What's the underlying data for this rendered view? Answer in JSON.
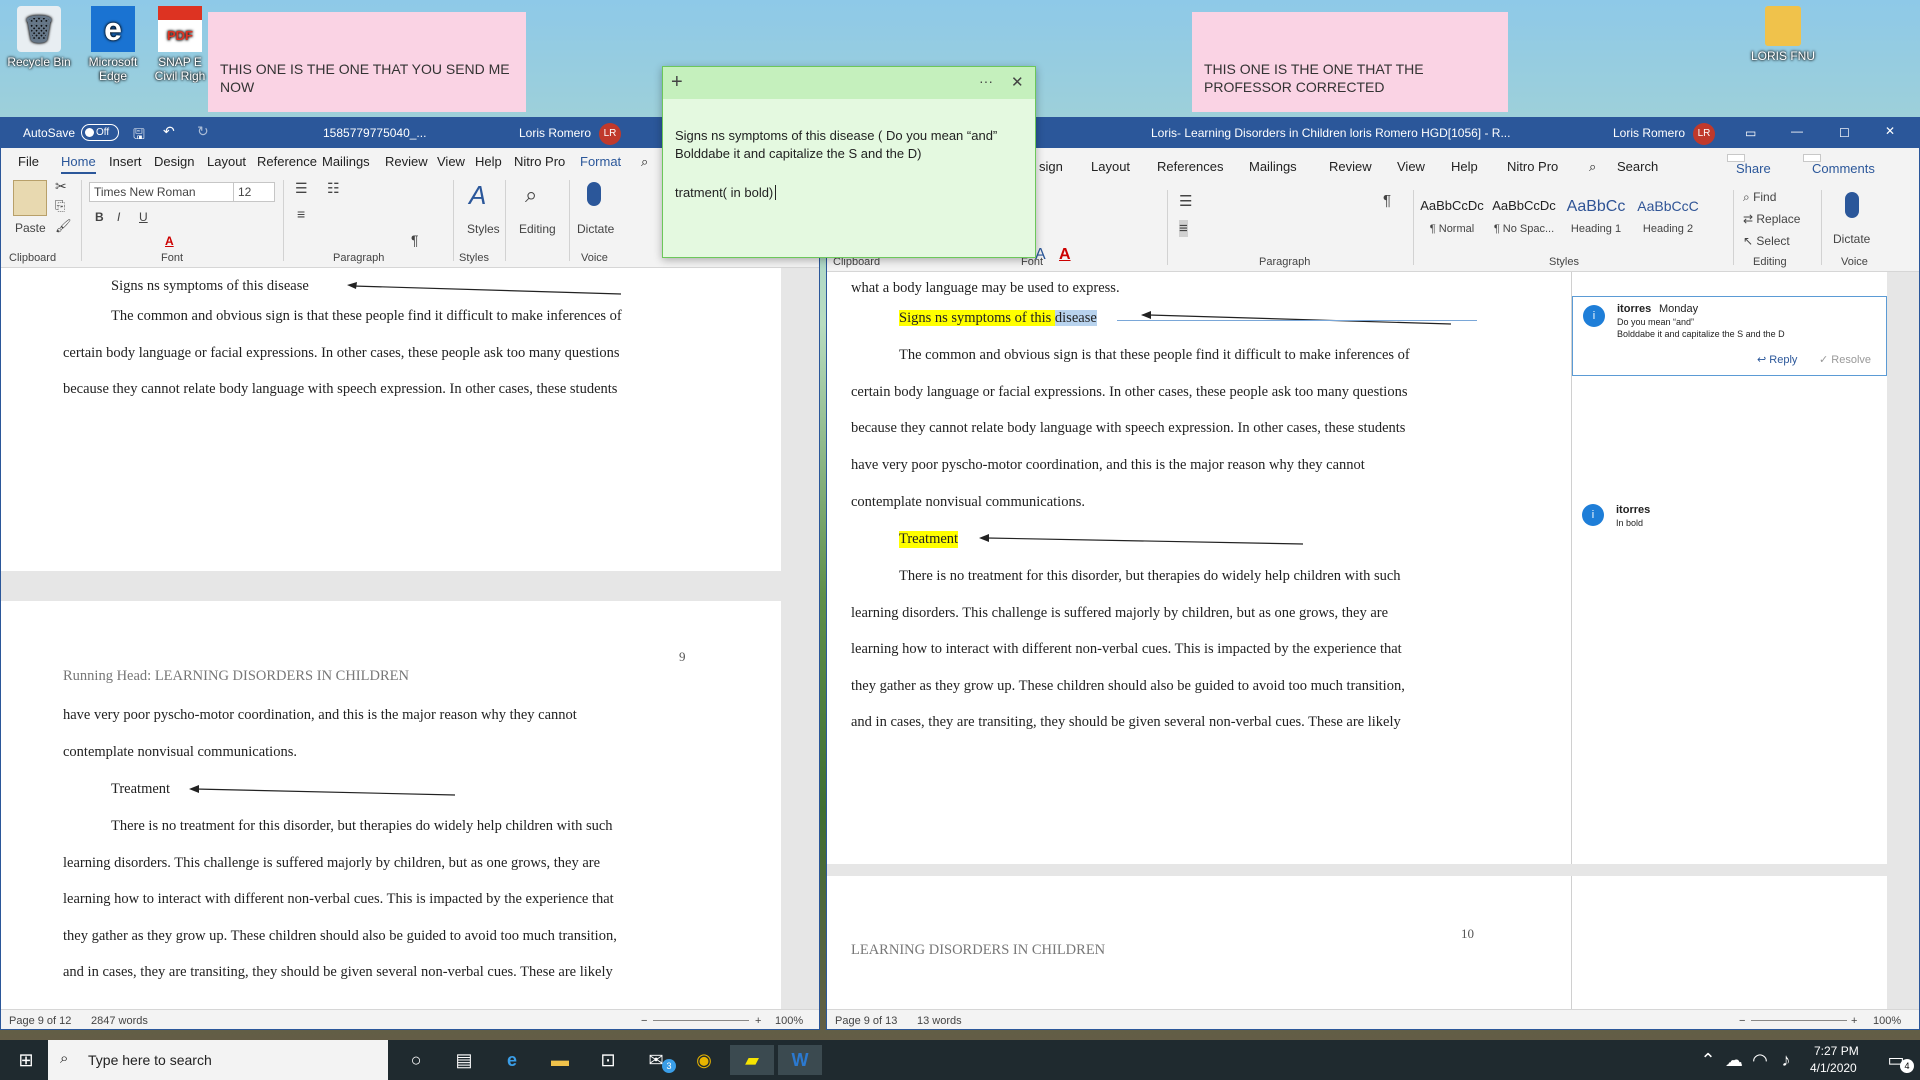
{
  "desktop": {
    "icons": [
      {
        "label": "Recycle Bin",
        "name": "recycle-bin-icon"
      },
      {
        "label": "Microsoft Edge",
        "name": "edge-icon"
      },
      {
        "label": "SNAP E Civil Righ",
        "name": "pdf-icon"
      },
      {
        "label": "LORIS FNU",
        "name": "folder-icon"
      }
    ],
    "sticky_left": "THIS ONE IS THE ONE THAT YOU SEND ME NOW",
    "sticky_right": "THIS ONE IS THE ONE THAT THE PROFESSOR CORRECTED"
  },
  "sticky_note": {
    "add": "+",
    "more": "···",
    "close": "✕",
    "line1": "Signs ns symptoms of this disease  ( Do you mean “and” Bolddabe it and capitalize the S and the D)",
    "line2": "tratment( in bold)"
  },
  "left_window": {
    "autosave_label": "AutoSave",
    "autosave_state": "Off",
    "title": "1585779775040_...",
    "user": "Loris Romero",
    "initials": "LR",
    "tabs": [
      "File",
      "Home",
      "Insert",
      "Design",
      "Layout",
      "Reference",
      "Mailings",
      "Review",
      "View",
      "Help",
      "Nitro Pro",
      "Format"
    ],
    "font_name": "Times New Roman",
    "font_size": "12",
    "groups": {
      "clipboard": "Clipboard",
      "font": "Font",
      "paragraph": "Paragraph",
      "styles": "Styles",
      "voice": "Voice"
    },
    "paste": "Paste",
    "styles_btn": "Styles",
    "editing_btn": "Editing",
    "dictate_btn": "Dictate",
    "page1": {
      "heading": "Signs ns symptoms of this disease",
      "lines": [
        "The common and obvious sign is that these people find it difficult to make inferences of",
        "certain body language or facial expressions. In other cases, these people ask too many questions",
        "because they cannot relate body language with speech expression. In other cases, these students"
      ]
    },
    "page2": {
      "page_number": "9",
      "running_head": "Running Head: LEARNING DISORDERS IN CHILDREN",
      "lines_a": [
        "have very poor pyscho-motor coordination, and this is the major reason why they cannot",
        "contemplate nonvisual communications."
      ],
      "heading": "Treatment",
      "lines_b": [
        "There is no treatment for this disorder, but therapies do widely help children with such",
        "learning disorders. This challenge is suffered majorly by children, but as one grows, they are",
        "learning how to interact with different non-verbal cues. This is impacted by the experience that",
        "they gather as they grow up. These children should also be guided to avoid too much transition,",
        "and in cases, they are transiting, they should be given several non-verbal cues. These are likely"
      ]
    },
    "status": {
      "page": "Page 9 of 12",
      "words": "2847 words",
      "zoom": "100%"
    }
  },
  "right_window": {
    "title": "Loris- Learning Disorders in Children loris Romero HGD[1056]  -  R...",
    "user": "Loris Romero",
    "initials": "LR",
    "tabs": [
      "sign",
      "Layout",
      "References",
      "Mailings",
      "Review",
      "View",
      "Help",
      "Nitro Pro",
      "Search"
    ],
    "share": "Share",
    "comments": "Comments",
    "styles": [
      {
        "sample": "AaBbCcDc",
        "name": "¶ Normal"
      },
      {
        "sample": "AaBbCcDc",
        "name": "¶ No Spac..."
      },
      {
        "sample": "AaBbCc",
        "name": "Heading 1"
      },
      {
        "sample": "AaBbCcC",
        "name": "Heading 2"
      }
    ],
    "find": "Find",
    "replace": "Replace",
    "select": "Select",
    "dictate": "Dictate",
    "groups": {
      "clipboard": "Clipboard",
      "font": "Font",
      "paragraph": "Paragraph",
      "styles": "Styles",
      "editing": "Editing",
      "voice": "Voice"
    },
    "doc": {
      "top_line": "what a body language may be used to express.",
      "heading1_a": "Signs ns symptoms of this ",
      "heading1_b": "disease",
      "lines_a": [
        "The common and obvious sign is that these people find it difficult to make inferences of",
        "certain body language or facial expressions. In other cases, these people ask too many questions",
        "because they cannot relate body language with speech expression. In other cases, these students",
        "have very poor pyscho-motor coordination, and this is the major reason why they cannot",
        "contemplate nonvisual communications."
      ],
      "heading2": "Treatment",
      "lines_b": [
        "There is no treatment for this disorder, but therapies do widely help children with such",
        "learning disorders. This challenge is suffered majorly by children, but as one grows, they are",
        "learning how to interact with different non-verbal cues. This is impacted by the experience that",
        "they gather as they grow up. These children should also be guided to avoid too much transition,",
        "and in cases, they are transiting, they should be given several non-verbal cues. These are likely"
      ],
      "page_number": "10",
      "running_head": "LEARNING DISORDERS IN CHILDREN"
    },
    "comments_list": [
      {
        "author": "itorres",
        "time": "Monday",
        "line1": "Do you mean “and”",
        "line2": "Bolddabe it and capitalize the S and the D",
        "reply": "Reply",
        "resolve": "Resolve"
      },
      {
        "author": "itorres",
        "time": "",
        "line1": "In bold"
      }
    ],
    "status": {
      "page": "Page 9 of 13",
      "words": "13 words",
      "zoom": "100%"
    }
  },
  "taskbar": {
    "search_placeholder": "Type here to search",
    "time": "7:27 PM",
    "date": "4/1/2020",
    "mail_badge": "3",
    "notif_badge": "4"
  }
}
